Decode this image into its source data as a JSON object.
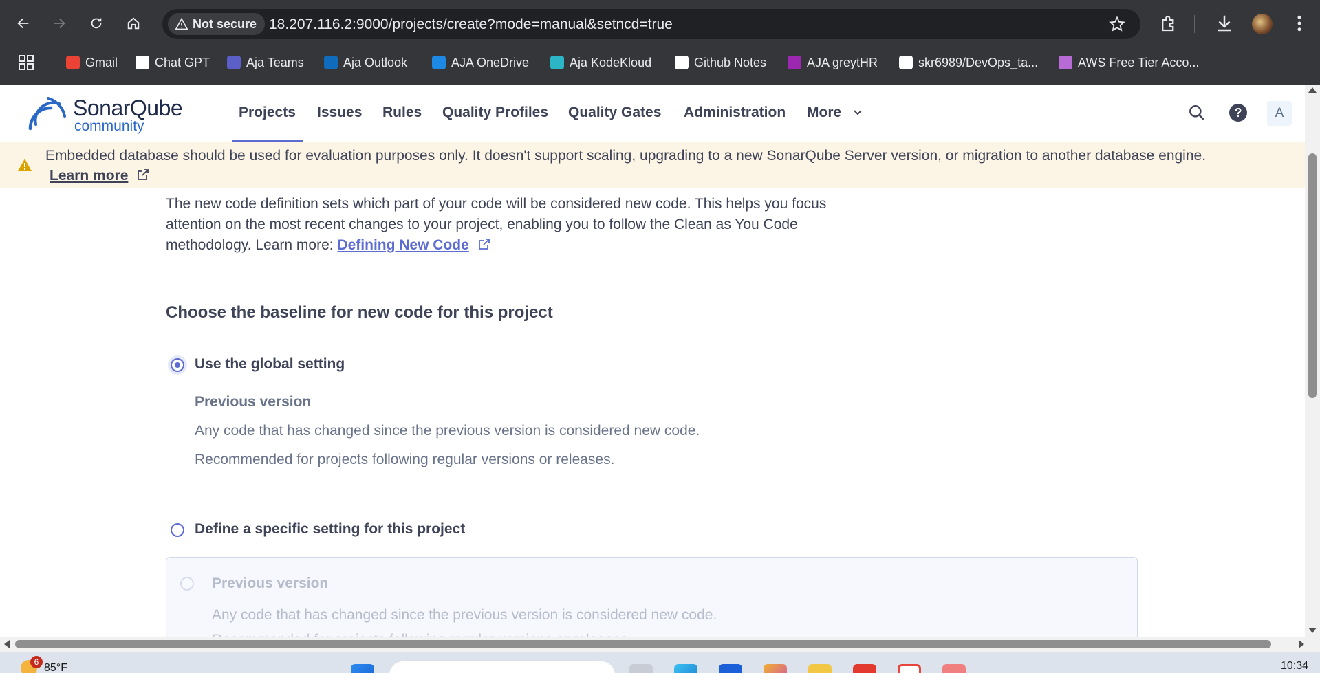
{
  "browser": {
    "security_label": "Not secure",
    "url": "18.207.116.2:9000/projects/create?mode=manual&setncd=true",
    "bookmarks": [
      {
        "label": "Gmail",
        "icon": "gmail-icon",
        "color": "#ea4335"
      },
      {
        "label": "Chat GPT",
        "icon": "chatgpt-icon",
        "color": "#ffffff"
      },
      {
        "label": "Aja Teams",
        "icon": "teams-icon",
        "color": "#5b5fc7"
      },
      {
        "label": "Aja Outlook",
        "icon": "outlook-icon",
        "color": "#0f6cbd"
      },
      {
        "label": "AJA OneDrive",
        "icon": "onedrive-icon",
        "color": "#1e88e5"
      },
      {
        "label": "Aja KodeKloud",
        "icon": "kodekloud-icon",
        "color": "#2bb5c5"
      },
      {
        "label": "Github Notes",
        "icon": "github-icon",
        "color": "#ffffff"
      },
      {
        "label": "AJA greytHR",
        "icon": "greythr-icon",
        "color": "#9c27b0"
      },
      {
        "label": "skr6989/DevOps_ta...",
        "icon": "github-icon",
        "color": "#ffffff"
      },
      {
        "label": "AWS Free Tier Acco...",
        "icon": "aws-icon",
        "color": "#b86bd6"
      }
    ]
  },
  "app": {
    "brand": "SonarQube",
    "edition": "community",
    "nav": [
      "Projects",
      "Issues",
      "Rules",
      "Quality Profiles",
      "Quality Gates",
      "Administration",
      "More"
    ],
    "active_nav": "Projects",
    "user_initial": "A",
    "accent_color": "#5d6cd0"
  },
  "banner": {
    "text": "Embedded database should be used for evaluation purposes only. It doesn't support scaling, upgrading to a new SonarQube Server version, or migration to another database engine.",
    "link": "Learn more"
  },
  "content": {
    "description": "The new code definition sets which part of your code will be considered new code. This helps you focus attention on the most recent changes to your project, enabling you to follow the Clean as You Code methodology. Learn more:",
    "description_link": "Defining New Code",
    "section_title": "Choose the baseline for new code for this project",
    "global_option": {
      "label": "Use the global setting",
      "checked": true,
      "setting_title": "Previous version",
      "setting_desc": "Any code that has changed since the previous version is considered new code.",
      "setting_note": "Recommended for projects following regular versions or releases."
    },
    "specific_option": {
      "label": "Define a specific setting for this project",
      "checked": false,
      "card_title": "Previous version",
      "card_desc": "Any code that has changed since the previous version is considered new code.",
      "card_note": "Recommended for projects following regular versions or releases."
    }
  },
  "taskbar": {
    "notification_count": "6",
    "temperature": "85°F",
    "time": "10:34"
  }
}
